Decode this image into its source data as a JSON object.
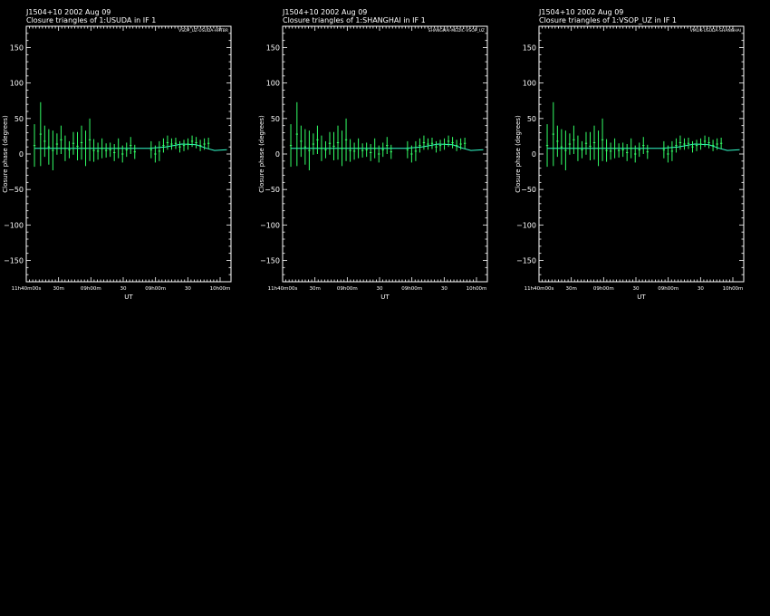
{
  "source_line": "J1504+10   2002 Aug 09",
  "x_ticks": [
    "11h40m00s",
    "30m",
    "09h00m",
    "30",
    "09h00m",
    "30",
    "10h00m"
  ],
  "y_ticks": [
    "150",
    "100",
    "50",
    "0",
    "−50",
    "−100",
    "−150"
  ],
  "xlabel": "UT",
  "ylabel": "Closure phase   (degrees)",
  "chart_data": [
    {
      "type": "scatter",
      "title": "Closure triangles of 1:USUDA in IF 1",
      "triangle_label": "VSOP_UZ-USUDA-HRTBR",
      "ylim": [
        -180,
        180
      ],
      "grid": false,
      "x": [
        0.04,
        0.07,
        0.09,
        0.11,
        0.13,
        0.15,
        0.17,
        0.19,
        0.21,
        0.23,
        0.25,
        0.27,
        0.29,
        0.31,
        0.33,
        0.35,
        0.37,
        0.39,
        0.41,
        0.43,
        0.45,
        0.47,
        0.49,
        0.51,
        0.53,
        0.61,
        0.63,
        0.65,
        0.67,
        0.69,
        0.71,
        0.73,
        0.75,
        0.77,
        0.79,
        0.81,
        0.83,
        0.85,
        0.87,
        0.89
      ],
      "y": [
        12,
        28,
        18,
        10,
        5,
        14,
        20,
        8,
        6,
        15,
        11,
        16,
        8,
        20,
        5,
        4,
        8,
        5,
        6,
        2,
        8,
        0,
        6,
        12,
        3,
        6,
        0,
        4,
        12,
        16,
        14,
        15,
        10,
        12,
        14,
        18,
        16,
        12,
        14,
        15
      ],
      "err": [
        30,
        45,
        22,
        25,
        28,
        15,
        20,
        18,
        12,
        16,
        20,
        24,
        25,
        30,
        16,
        12,
        14,
        10,
        10,
        12,
        14,
        12,
        10,
        12,
        10,
        12,
        12,
        14,
        10,
        10,
        8,
        8,
        8,
        8,
        8,
        8,
        8,
        8,
        8,
        8
      ],
      "model_x": [
        0.04,
        0.6,
        0.68,
        0.76,
        0.83,
        0.88,
        0.92,
        0.98
      ],
      "model_y": [
        8,
        8,
        10,
        14,
        13,
        8,
        5,
        6
      ]
    },
    {
      "type": "scatter",
      "title": "Closure triangles of 1:SHANGHAI in IF 1",
      "triangle_label": "SHANGHAI-MEDIC-VSOP_UZ",
      "ylim": [
        -180,
        180
      ],
      "grid": false,
      "x": [
        0.04,
        0.07,
        0.09,
        0.11,
        0.13,
        0.15,
        0.17,
        0.19,
        0.21,
        0.23,
        0.25,
        0.27,
        0.29,
        0.31,
        0.33,
        0.35,
        0.37,
        0.39,
        0.41,
        0.43,
        0.45,
        0.47,
        0.49,
        0.51,
        0.53,
        0.61,
        0.63,
        0.65,
        0.67,
        0.69,
        0.71,
        0.73,
        0.75,
        0.77,
        0.79,
        0.81,
        0.83,
        0.85,
        0.87,
        0.89
      ],
      "y": [
        12,
        28,
        18,
        10,
        5,
        14,
        20,
        8,
        6,
        15,
        11,
        16,
        8,
        20,
        5,
        4,
        8,
        5,
        6,
        2,
        8,
        0,
        6,
        12,
        3,
        6,
        0,
        4,
        12,
        16,
        14,
        15,
        10,
        12,
        14,
        18,
        16,
        12,
        14,
        15
      ],
      "err": [
        30,
        45,
        22,
        25,
        28,
        15,
        20,
        18,
        12,
        16,
        20,
        24,
        25,
        30,
        16,
        12,
        14,
        10,
        10,
        12,
        14,
        12,
        10,
        12,
        10,
        12,
        12,
        14,
        10,
        10,
        8,
        8,
        8,
        8,
        8,
        8,
        8,
        8,
        8,
        8
      ],
      "model_x": [
        0.04,
        0.6,
        0.68,
        0.76,
        0.83,
        0.88,
        0.92,
        0.98
      ],
      "model_y": [
        8,
        8,
        10,
        14,
        13,
        8,
        5,
        6
      ]
    },
    {
      "type": "scatter",
      "title": "Closure triangles of 1:VSOP_UZ in IF 1",
      "triangle_label": "VMLIK-USUDA-SHANGHAI",
      "ylim": [
        -180,
        180
      ],
      "grid": false,
      "x": [
        0.04,
        0.07,
        0.09,
        0.11,
        0.13,
        0.15,
        0.17,
        0.19,
        0.21,
        0.23,
        0.25,
        0.27,
        0.29,
        0.31,
        0.33,
        0.35,
        0.37,
        0.39,
        0.41,
        0.43,
        0.45,
        0.47,
        0.49,
        0.51,
        0.53,
        0.61,
        0.63,
        0.65,
        0.67,
        0.69,
        0.71,
        0.73,
        0.75,
        0.77,
        0.79,
        0.81,
        0.83,
        0.85,
        0.87,
        0.89
      ],
      "y": [
        12,
        28,
        18,
        10,
        5,
        14,
        20,
        8,
        6,
        15,
        11,
        16,
        8,
        20,
        5,
        4,
        8,
        5,
        6,
        2,
        8,
        0,
        6,
        12,
        3,
        6,
        0,
        4,
        12,
        16,
        14,
        15,
        10,
        12,
        14,
        18,
        16,
        12,
        14,
        15
      ],
      "err": [
        30,
        45,
        22,
        25,
        28,
        15,
        20,
        18,
        12,
        16,
        20,
        24,
        25,
        30,
        16,
        12,
        14,
        10,
        10,
        12,
        14,
        12,
        10,
        12,
        10,
        12,
        12,
        14,
        10,
        10,
        8,
        8,
        8,
        8,
        8,
        8,
        8,
        8,
        8,
        8
      ],
      "model_x": [
        0.04,
        0.6,
        0.68,
        0.76,
        0.83,
        0.88,
        0.92,
        0.98
      ],
      "model_y": [
        8,
        8,
        10,
        14,
        13,
        8,
        5,
        6
      ]
    }
  ],
  "colors": {
    "background": "#000000",
    "axes": "#ffffff",
    "data": "#33ff66",
    "model": "#33ffcc"
  }
}
